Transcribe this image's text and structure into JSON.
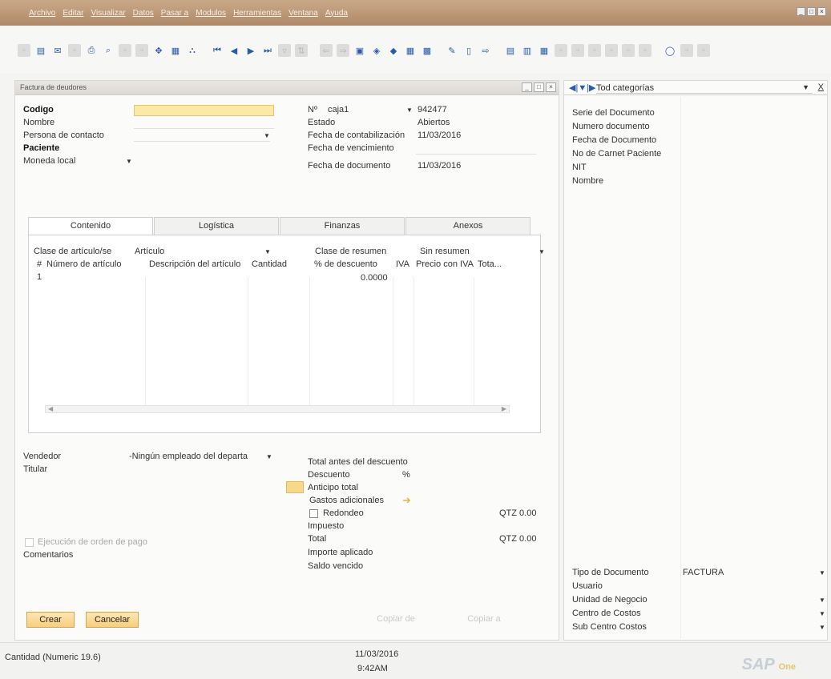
{
  "menu": [
    "Archivo",
    "Editar",
    "Visualizar",
    "Datos",
    "Pasar a",
    "Modulos",
    "Herramientas",
    "Ventana",
    "Ayuda"
  ],
  "window_controls": [
    "_",
    "□",
    "×"
  ],
  "doc": {
    "title": "Factura de deudores",
    "codigo_label": "Codigo",
    "nombre_label": "Nombre",
    "persona_label": "Persona de contacto",
    "paciente_label": "Paciente",
    "moneda_label": "Moneda local",
    "nf_label": "Nº",
    "nf_series": "caja1",
    "nf_number": "942477",
    "estado_label": "Estado",
    "estado_value": "Abiertos",
    "fecha_contab_label": "Fecha de contabilización",
    "fecha_contab_value": "11/03/2016",
    "fecha_venc_label": "Fecha de vencimiento",
    "fecha_doc_label": "Fecha de documento",
    "fecha_doc_value": "11/03/2016"
  },
  "tabs": [
    "Contenido",
    "Logística",
    "Finanzas",
    "Anexos"
  ],
  "content": {
    "clase_label": "Clase de artículo/se",
    "clase_value": "Artículo",
    "resumen_label": "Clase de resumen",
    "resumen_value": "Sin resumen",
    "columns": [
      "#",
      "Número de artículo",
      "Descripción del artículo",
      "Cantidad",
      "% de descuento",
      "IVA",
      "Precio con IVA",
      "Tota..."
    ],
    "row1_num": "1",
    "row1_discount": "0.0000"
  },
  "footer": {
    "vendedor_label": "Vendedor",
    "vendedor_value": "-Ningún empleado del departa",
    "titular_label": "Titular",
    "ejecucion_label": "Ejecución de orden de pago",
    "comentarios_label": "Comentarios",
    "total_antes_label": "Total antes del descuento",
    "descuento_label": "Descuento",
    "descuento_pct": "%",
    "anticipo_label": "Anticipo total",
    "gastos_label": "Gastos adicionales",
    "redondeo_label": "Redondeo",
    "redondeo_value": "QTZ 0.00",
    "impuesto_label": "Impuesto",
    "total_label": "Total",
    "total_value": "QTZ 0.00",
    "importe_label": "Importe aplicado",
    "saldo_label": "Saldo vencido",
    "crear_label": "Crear",
    "cancelar_label": "Cancelar",
    "copiar_de_label": "Copiar de",
    "copiar_a_label": "Copiar a"
  },
  "right_panel": {
    "category": "Tod categorías",
    "fields": [
      "Serie del Documento",
      "Numero documento",
      "Fecha de Documento",
      "No de Carnet Paciente",
      "NIT",
      "Nombre"
    ],
    "tipo_label": "Tipo de Documento",
    "tipo_value": "FACTURA",
    "usuario_label": "Usuario",
    "unidad_label": "Unidad de Negocio",
    "centro_label": "Centro de Costos",
    "subcentro_label": "Sub Centro Costos"
  },
  "status": {
    "left_text": "Cantidad (Numeric 19.6)",
    "date": "11/03/2016",
    "time": "9:42AM",
    "logo_main": "SAP",
    "logo_sub": "One"
  }
}
